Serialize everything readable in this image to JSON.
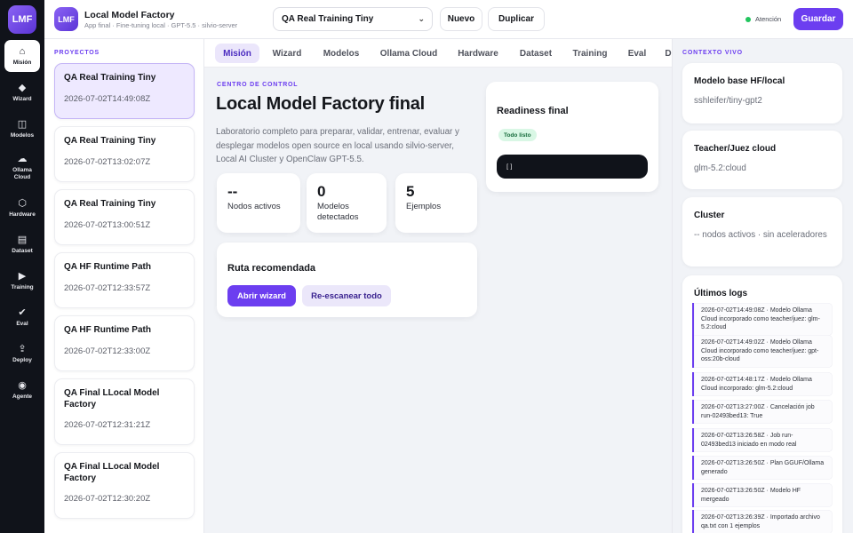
{
  "rail": {
    "logo": "LMF",
    "items": [
      {
        "label": "Misión",
        "icon": "home-icon",
        "glyph": "⌂"
      },
      {
        "label": "Wizard",
        "icon": "diamond-icon",
        "glyph": "◆"
      },
      {
        "label": "Modelos",
        "icon": "book-icon",
        "glyph": "◫"
      },
      {
        "label": "Ollama Cloud",
        "icon": "cloud-icon",
        "glyph": "☁"
      },
      {
        "label": "Hardware",
        "icon": "hexagon-icon",
        "glyph": "⬡"
      },
      {
        "label": "Dataset",
        "icon": "table-icon",
        "glyph": "▤"
      },
      {
        "label": "Training",
        "icon": "play-icon",
        "glyph": "▶"
      },
      {
        "label": "Eval",
        "icon": "check-icon",
        "glyph": "✔"
      },
      {
        "label": "Deploy",
        "icon": "upload-icon",
        "glyph": "⇪"
      },
      {
        "label": "Agente",
        "icon": "target-icon",
        "glyph": "◉"
      }
    ]
  },
  "header": {
    "logo": "LMF",
    "title": "Local Model Factory",
    "subtitle": "App final · Fine-tuning local · GPT-5.5 · silvio-server",
    "project_select": "QA Real Training Tiny",
    "new_label": "Nuevo",
    "duplicate_label": "Duplicar",
    "status": "Atención",
    "save_label": "Guardar"
  },
  "projects": {
    "label": "PROYECTOS",
    "items": [
      {
        "name": "QA Real Training Tiny",
        "date": "2026-07-02T14:49:08Z"
      },
      {
        "name": "QA Real Training Tiny",
        "date": "2026-07-02T13:02:07Z"
      },
      {
        "name": "QA Real Training Tiny",
        "date": "2026-07-02T13:00:51Z"
      },
      {
        "name": "QA HF Runtime Path",
        "date": "2026-07-02T12:33:57Z"
      },
      {
        "name": "QA HF Runtime Path",
        "date": "2026-07-02T12:33:00Z"
      },
      {
        "name": "QA Final LLocal Model Factory",
        "date": "2026-07-02T12:31:21Z"
      },
      {
        "name": "QA Final LLocal Model Factory",
        "date": "2026-07-02T12:30:20Z"
      }
    ]
  },
  "tabs": [
    "Misión",
    "Wizard",
    "Modelos",
    "Ollama Cloud",
    "Hardware",
    "Dataset",
    "Training",
    "Eval",
    "D"
  ],
  "main": {
    "label": "CENTRO DE CONTROL",
    "title": "Local Model Factory final",
    "description": "Laboratorio completo para preparar, validar, entrenar, evaluar y desplegar modelos open source en local usando silvio-server, Local AI Cluster y OpenClaw GPT-5.5.",
    "metrics": [
      {
        "value": "--",
        "label": "Nodos activos"
      },
      {
        "value": "0",
        "label": "Modelos detectados"
      },
      {
        "value": "5",
        "label": "Ejemplos"
      }
    ],
    "readiness": {
      "title": "Readiness final",
      "badge": "Todo listo",
      "code": "[]"
    },
    "route": {
      "title": "Ruta recomendada",
      "primary": "Abrir wizard",
      "secondary": "Re-escanear todo"
    }
  },
  "context": {
    "label": "CONTEXTO VIVO",
    "cards": [
      {
        "title": "Modelo base HF/local",
        "value": "sshleifer/tiny-gpt2"
      },
      {
        "title": "Teacher/Juez cloud",
        "value": "glm-5.2:cloud"
      },
      {
        "title": "Cluster",
        "value": "-- nodos activos · sin aceleradores"
      }
    ],
    "logs_title": "Últimos logs",
    "logs": [
      "2026-07-02T14:49:08Z · Modelo Ollama Cloud incorporado como teacher/juez: glm-5.2:cloud",
      "2026-07-02T14:49:02Z · Modelo Ollama Cloud incorporado como teacher/juez: gpt-oss:20b-cloud",
      "2026-07-02T14:48:17Z · Modelo Ollama Cloud incorporado: glm-5.2:cloud",
      "2026-07-02T13:27:00Z · Cancelación job run-02493bed13: True",
      "2026-07-02T13:26:58Z · Job run-02493bed13 iniciado en modo real",
      "2026-07-02T13:26:50Z · Plan GGUF/Ollama generado",
      "2026-07-02T13:26:50Z · Modelo HF mergeado",
      "2026-07-02T13:26:39Z · Importado archivo qa.txt con 1 ejemplos"
    ]
  },
  "colors": {
    "accent": "#6c3ef0",
    "rail": "#10131a",
    "ok": "#22c55e"
  }
}
